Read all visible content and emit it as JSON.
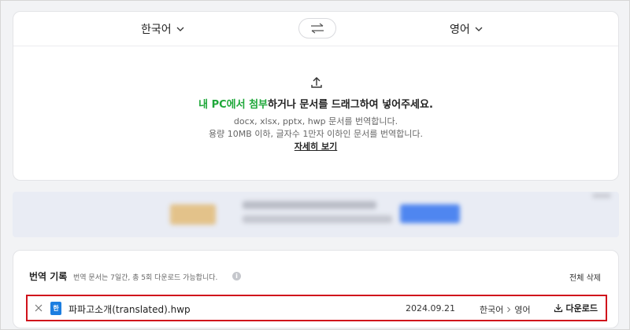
{
  "translator": {
    "source_lang": "한국어",
    "target_lang": "영어",
    "upload": {
      "attach_link_1": "내 PC에서",
      "attach_link_2": "첨부",
      "headline_rest": "하거나 문서를 드래그하여 넣어주세요.",
      "formats_note": "docx, xlsx, pptx, hwp 문서를 번역합니다.",
      "limit_note": "용량 10MB 이하, 글자수 1만자 이하인 문서를 번역합니다.",
      "details_link": "자세히 보기"
    }
  },
  "history": {
    "title": "번역 기록",
    "note": "번역 문서는 7일간, 총 5회 다운로드 가능합니다.",
    "delete_all": "전체 삭제",
    "items": [
      {
        "file_badge": "한",
        "file_name": "파파고소개(translated).hwp",
        "date": "2024.09.21",
        "source_lang": "한국어",
        "target_lang": "영어",
        "download_label": "다운로드"
      }
    ]
  },
  "colors": {
    "accent_green": "#1fa83a",
    "highlight_red": "#d0121b",
    "file_blue": "#1c7ee0"
  }
}
